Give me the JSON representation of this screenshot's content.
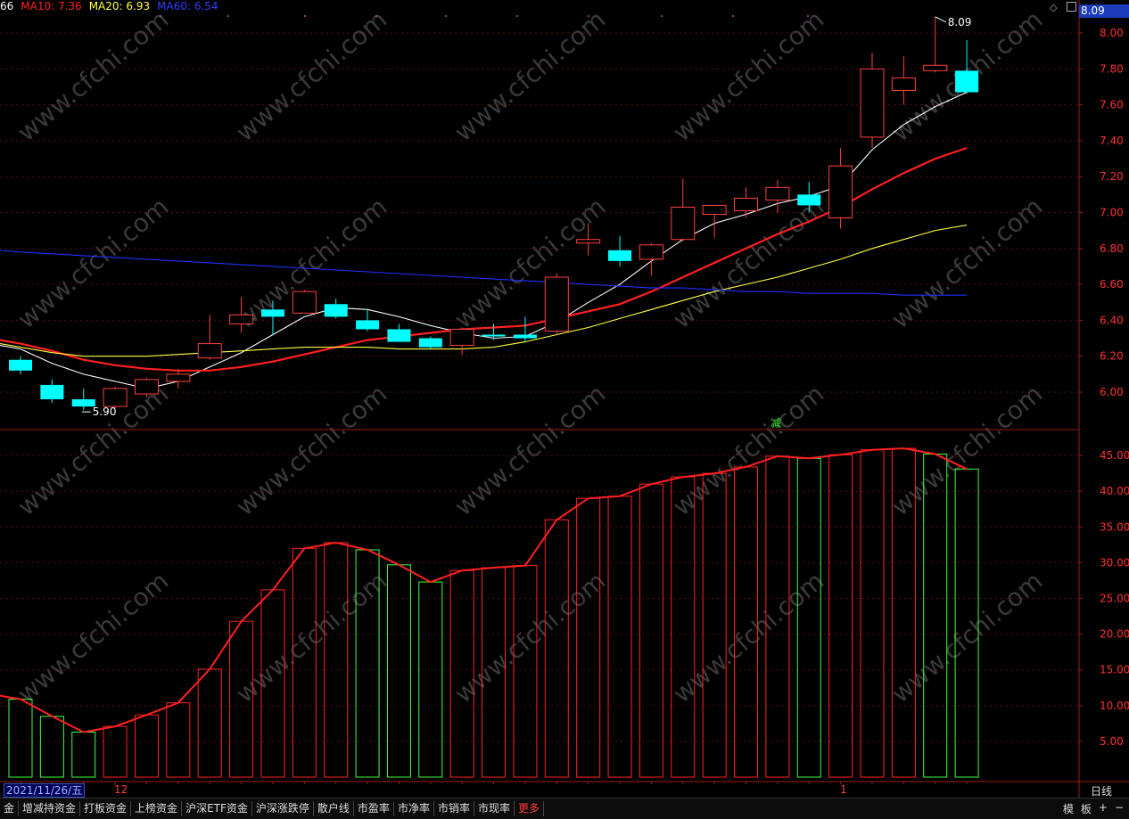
{
  "legend": {
    "ma5_fragment": "66",
    "ma10": "MA10: 7.36",
    "ma20": "MA20: 6.93",
    "ma60": "MA60: 6.54",
    "colors": {
      "ma5": "#ffffff",
      "ma10": "#ff2020",
      "ma20": "#ffff40",
      "ma60": "#2030ff"
    }
  },
  "price_tag": "8.09",
  "bottom_bar": {
    "date": "2021/11/26/五",
    "x_marks": [
      "12",
      "1"
    ],
    "period": "日线",
    "tabs": [
      "金",
      "增减持资金",
      "打板资金",
      "上榜资金",
      "沪深ETF资金",
      "沪深涨跌停",
      "散户线",
      "市盈率",
      "市净率",
      "市销率",
      "市现率",
      "更多"
    ],
    "right_buttons": [
      "模",
      "板",
      "+",
      "−"
    ]
  },
  "annotations": {
    "high_label": "8.09",
    "low_label": "5.90",
    "signal_label": "减"
  },
  "watermark": "www.cfchi.com",
  "chart_data": [
    {
      "type": "candlestick",
      "price_axis": {
        "ticks": [
          "8.00",
          "7.80",
          "7.60",
          "7.40",
          "7.20",
          "7.00",
          "6.80",
          "6.60",
          "6.40",
          "6.20",
          "6.00"
        ],
        "ylim": [
          5.84,
          8.12
        ]
      },
      "colors": {
        "up": "#ff4040",
        "down": "#00ffff"
      },
      "candles": [
        {
          "o": 6.18,
          "h": 6.2,
          "l": 6.1,
          "c": 6.12
        },
        {
          "o": 6.04,
          "h": 6.07,
          "l": 5.94,
          "c": 5.96
        },
        {
          "o": 5.96,
          "h": 6.02,
          "l": 5.9,
          "c": 5.92
        },
        {
          "o": 5.92,
          "h": 6.03,
          "l": 5.91,
          "c": 6.02
        },
        {
          "o": 5.99,
          "h": 6.08,
          "l": 5.97,
          "c": 6.07
        },
        {
          "o": 6.06,
          "h": 6.13,
          "l": 6.02,
          "c": 6.1
        },
        {
          "o": 6.19,
          "h": 6.43,
          "l": 6.18,
          "c": 6.27
        },
        {
          "o": 6.38,
          "h": 6.53,
          "l": 6.33,
          "c": 6.43
        },
        {
          "o": 6.46,
          "h": 6.51,
          "l": 6.32,
          "c": 6.42
        },
        {
          "o": 6.44,
          "h": 6.57,
          "l": 6.44,
          "c": 6.56
        },
        {
          "o": 6.49,
          "h": 6.52,
          "l": 6.41,
          "c": 6.42
        },
        {
          "o": 6.4,
          "h": 6.46,
          "l": 6.34,
          "c": 6.35
        },
        {
          "o": 6.35,
          "h": 6.38,
          "l": 6.28,
          "c": 6.28
        },
        {
          "o": 6.3,
          "h": 6.31,
          "l": 6.24,
          "c": 6.25
        },
        {
          "o": 6.26,
          "h": 6.36,
          "l": 6.21,
          "c": 6.35
        },
        {
          "o": 6.32,
          "h": 6.38,
          "l": 6.29,
          "c": 6.31
        },
        {
          "o": 6.32,
          "h": 6.42,
          "l": 6.28,
          "c": 6.3
        },
        {
          "o": 6.34,
          "h": 6.66,
          "l": 6.32,
          "c": 6.64
        },
        {
          "o": 6.83,
          "h": 6.94,
          "l": 6.76,
          "c": 6.85
        },
        {
          "o": 6.79,
          "h": 6.87,
          "l": 6.7,
          "c": 6.73
        },
        {
          "o": 6.74,
          "h": 6.83,
          "l": 6.65,
          "c": 6.82
        },
        {
          "o": 6.85,
          "h": 7.19,
          "l": 6.84,
          "c": 7.03
        },
        {
          "o": 6.99,
          "h": 7.04,
          "l": 6.86,
          "c": 7.04
        },
        {
          "o": 7.01,
          "h": 7.14,
          "l": 6.97,
          "c": 7.08
        },
        {
          "o": 7.07,
          "h": 7.18,
          "l": 7.0,
          "c": 7.14
        },
        {
          "o": 7.1,
          "h": 7.17,
          "l": 7.0,
          "c": 7.04
        },
        {
          "o": 6.97,
          "h": 7.36,
          "l": 6.91,
          "c": 7.26
        },
        {
          "o": 7.42,
          "h": 7.89,
          "l": 7.36,
          "c": 7.8
        },
        {
          "o": 7.68,
          "h": 7.87,
          "l": 7.6,
          "c": 7.75
        },
        {
          "o": 7.79,
          "h": 8.09,
          "l": 7.78,
          "c": 7.82
        },
        {
          "o": 7.79,
          "h": 7.96,
          "l": 7.66,
          "c": 7.67
        }
      ],
      "ma": [
        {
          "name": "MA5",
          "color": "#ffffff",
          "values": [
            6.24,
            6.16,
            6.1,
            6.06,
            6.02,
            6.06,
            6.14,
            6.22,
            6.32,
            6.42,
            6.47,
            6.46,
            6.42,
            6.37,
            6.33,
            6.3,
            6.31,
            6.39,
            6.5,
            6.6,
            6.73,
            6.85,
            6.94,
            6.99,
            7.05,
            7.09,
            7.15,
            7.35,
            7.49,
            7.59,
            7.67
          ]
        },
        {
          "name": "MA10",
          "color": "#ff2020",
          "values": [
            6.27,
            6.23,
            6.18,
            6.15,
            6.13,
            6.12,
            6.12,
            6.14,
            6.17,
            6.21,
            6.25,
            6.29,
            6.31,
            6.33,
            6.35,
            6.36,
            6.37,
            6.41,
            6.45,
            6.49,
            6.56,
            6.64,
            6.72,
            6.8,
            6.88,
            6.95,
            7.03,
            7.13,
            7.22,
            7.3,
            7.36
          ]
        },
        {
          "name": "MA20",
          "color": "#ffff40",
          "values": [
            6.25,
            6.22,
            6.2,
            6.2,
            6.2,
            6.21,
            6.22,
            6.23,
            6.24,
            6.25,
            6.25,
            6.25,
            6.24,
            6.24,
            6.24,
            6.25,
            6.28,
            6.32,
            6.36,
            6.41,
            6.46,
            6.51,
            6.56,
            6.6,
            6.64,
            6.69,
            6.74,
            6.8,
            6.85,
            6.9,
            6.93
          ]
        },
        {
          "name": "MA60",
          "color": "#2030ff",
          "values": [
            6.78,
            6.77,
            6.76,
            6.75,
            6.74,
            6.73,
            6.72,
            6.71,
            6.7,
            6.69,
            6.68,
            6.67,
            6.66,
            6.65,
            6.64,
            6.63,
            6.62,
            6.61,
            6.6,
            6.59,
            6.58,
            6.58,
            6.57,
            6.56,
            6.56,
            6.55,
            6.55,
            6.55,
            6.54,
            6.54,
            6.54
          ]
        }
      ]
    },
    {
      "type": "bar",
      "y_axis": {
        "ticks": [
          "45.00",
          "40.00",
          "35.00",
          "30.00",
          "25.00",
          "20.00",
          "15.00",
          "10.00",
          "5.00"
        ],
        "ylim": [
          0,
          48.5
        ]
      },
      "values": [
        10.9,
        8.5,
        6.3,
        7.1,
        8.7,
        10.4,
        15.1,
        21.8,
        26.2,
        32.0,
        32.8,
        31.8,
        29.7,
        27.3,
        28.9,
        29.3,
        29.6,
        36.0,
        39.0,
        39.3,
        41.0,
        42.0,
        42.5,
        43.4,
        44.9,
        44.6,
        45.1,
        45.8,
        46.0,
        45.2,
        43.1
      ],
      "bar_colors": [
        "green",
        "green",
        "green",
        "red",
        "red",
        "red",
        "red",
        "red",
        "red",
        "red",
        "red",
        "green",
        "green",
        "green",
        "red",
        "red",
        "red",
        "red",
        "red",
        "red",
        "red",
        "red",
        "red",
        "red",
        "red",
        "green",
        "red",
        "red",
        "red",
        "green",
        "green"
      ],
      "line_color": "#ff2020"
    }
  ]
}
